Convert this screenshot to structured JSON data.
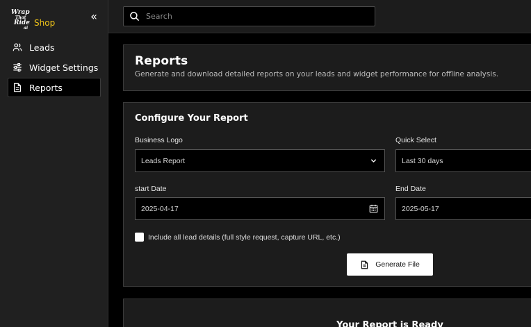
{
  "brand": {
    "logo_line1": "Wrap",
    "logo_line2": "That",
    "logo_line3": "Ride",
    "logo_line4": "ai",
    "shop": "Shop",
    "collapse_glyph": "«"
  },
  "sidebar": {
    "items": [
      {
        "label": "Leads",
        "icon": "users-icon",
        "active": false
      },
      {
        "label": "Widget Settings",
        "icon": "sliders-icon",
        "active": false
      },
      {
        "label": "Reports",
        "icon": "document-icon",
        "active": true
      }
    ]
  },
  "search": {
    "placeholder": "Search",
    "value": ""
  },
  "header": {
    "title": "Reports",
    "subtitle": "Generate and download detailed reports on your leads and widget performance for offline analysis."
  },
  "config": {
    "title": "Configure Your Report",
    "business_logo": {
      "label": "Business Logo",
      "value": "Leads Report"
    },
    "quick_select": {
      "label": "Quick Select",
      "value": "Last 30 days"
    },
    "start_date": {
      "label": "start Date",
      "value": "2025-04-17"
    },
    "end_date": {
      "label": "End Date",
      "value": "2025-05-17"
    },
    "include_details": {
      "label": "Include all lead details (full style request, capture URL, etc.)",
      "checked": false
    },
    "generate_label": "Generate File"
  },
  "ready": {
    "title": "Your Report is Ready"
  },
  "colors": {
    "accent": "#f0c419",
    "background": "#000000",
    "panel": "#1c1c1c",
    "sidebar": "#202020"
  }
}
